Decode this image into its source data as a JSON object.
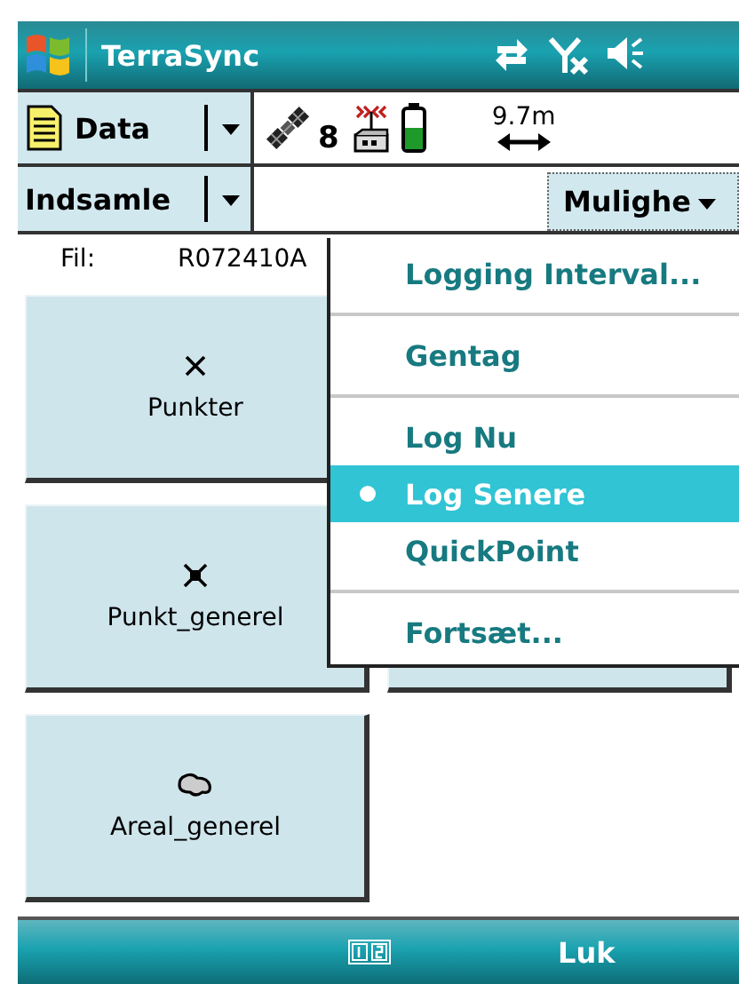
{
  "window": {
    "title": "TerraSync"
  },
  "toolbar": {
    "section_dropdown": "Data",
    "satellites": "8",
    "accuracy": "9.7m"
  },
  "subbar": {
    "mode_dropdown": "Indsamle",
    "options_button": "Mulighe"
  },
  "file": {
    "label": "Fil:",
    "value": "R072410A"
  },
  "features": [
    {
      "kind": "point",
      "label": "Punkter"
    },
    {
      "kind": "blank"
    },
    {
      "kind": "point-filled",
      "label": "Punkt_generel"
    },
    {
      "kind": "covered"
    },
    {
      "kind": "area",
      "label": "Areal_generel"
    }
  ],
  "menu": [
    {
      "kind": "item",
      "label": "Logging Interval...",
      "selected": false
    },
    {
      "kind": "separator"
    },
    {
      "kind": "item",
      "label": "Gentag",
      "selected": false
    },
    {
      "kind": "separator"
    },
    {
      "kind": "item",
      "label": "Log Nu",
      "selected": false
    },
    {
      "kind": "item",
      "label": "Log Senere",
      "selected": true
    },
    {
      "kind": "item",
      "label": "QuickPoint",
      "selected": false
    },
    {
      "kind": "separator"
    },
    {
      "kind": "item",
      "label": "Fortsæt...",
      "selected": false
    }
  ],
  "bottom_bar": {
    "right_softkey": "Luk"
  }
}
